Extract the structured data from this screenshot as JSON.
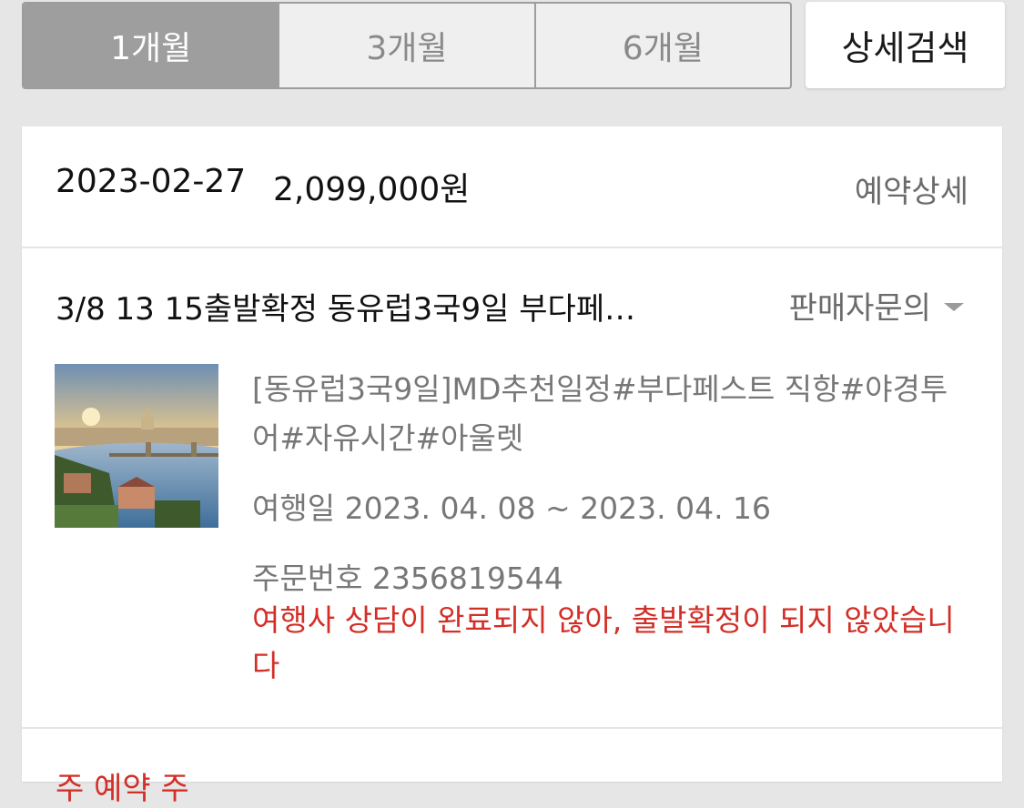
{
  "period_tabs": [
    {
      "label": "1개월",
      "active": true
    },
    {
      "label": "3개월",
      "active": false
    },
    {
      "label": "6개월",
      "active": false
    }
  ],
  "detail_search_label": "상세검색",
  "order": {
    "date": "2023-02-27",
    "price": "2,099,000원",
    "detail_link": "예약상세",
    "product_title": "3/8 13 15출발확정 동유럽3국9일 부다페…",
    "seller_inquiry": "판매자문의",
    "description": "[동유럽3국9일]MD추천일정#부다페스트 직항#야경투어#자유시간#아울렛",
    "travel_dates": "여행일  2023. 04. 08 ~ 2023. 04. 16",
    "order_number": "주문번호 2356819544",
    "status_message": "여행사 상담이 완료되지 않아, 출발확정이 되지 않았습니다"
  },
  "next_section_label": "주 예약 주",
  "colors": {
    "accent_red": "#d22f27",
    "active_tab_bg": "#9e9e9e",
    "page_bg": "#e6e6e6"
  },
  "icons": {
    "seller_inquiry": "caret-down-icon"
  }
}
